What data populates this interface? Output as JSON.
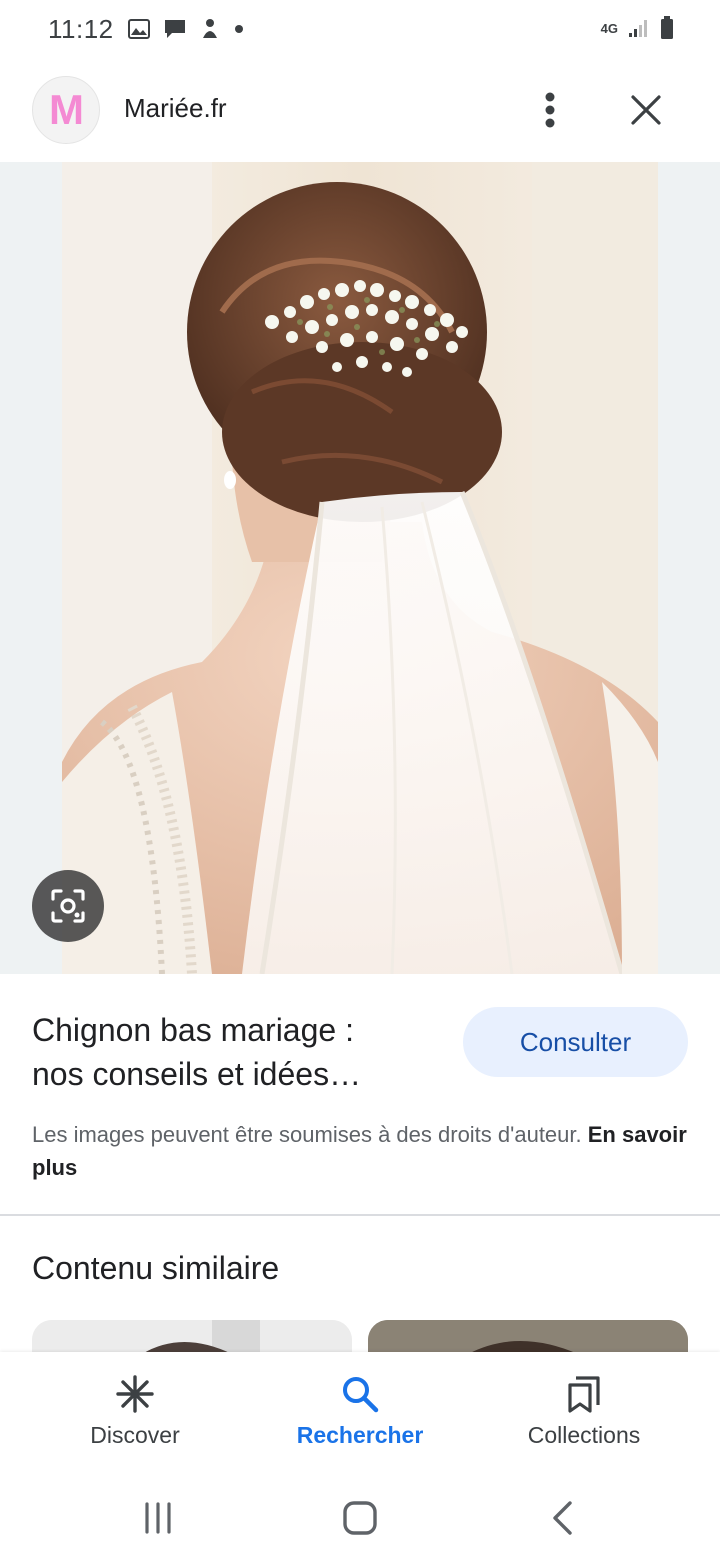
{
  "status_bar": {
    "time": "11:12",
    "network": "4G"
  },
  "header": {
    "logo_letter": "M",
    "site_name": "Mariée.fr"
  },
  "result": {
    "title_line1": "Chignon bas mariage :",
    "title_line2": "nos conseils et idées…",
    "consult_label": "Consulter",
    "copyright_text": "Les images peuvent être soumises à des droits d'auteur. ",
    "learn_more": "En savoir plus"
  },
  "similar": {
    "heading": "Contenu similaire"
  },
  "bottom_nav": {
    "items": [
      {
        "label": "Discover",
        "icon": "asterisk-icon",
        "active": false
      },
      {
        "label": "Rechercher",
        "icon": "search-icon",
        "active": true
      },
      {
        "label": "Collections",
        "icon": "bookmarks-icon",
        "active": false
      }
    ]
  },
  "colors": {
    "accent": "#1a73e8",
    "consult_bg": "#e8f0fe",
    "consult_text": "#174ea6",
    "logo_pink": "#f48ad3"
  }
}
